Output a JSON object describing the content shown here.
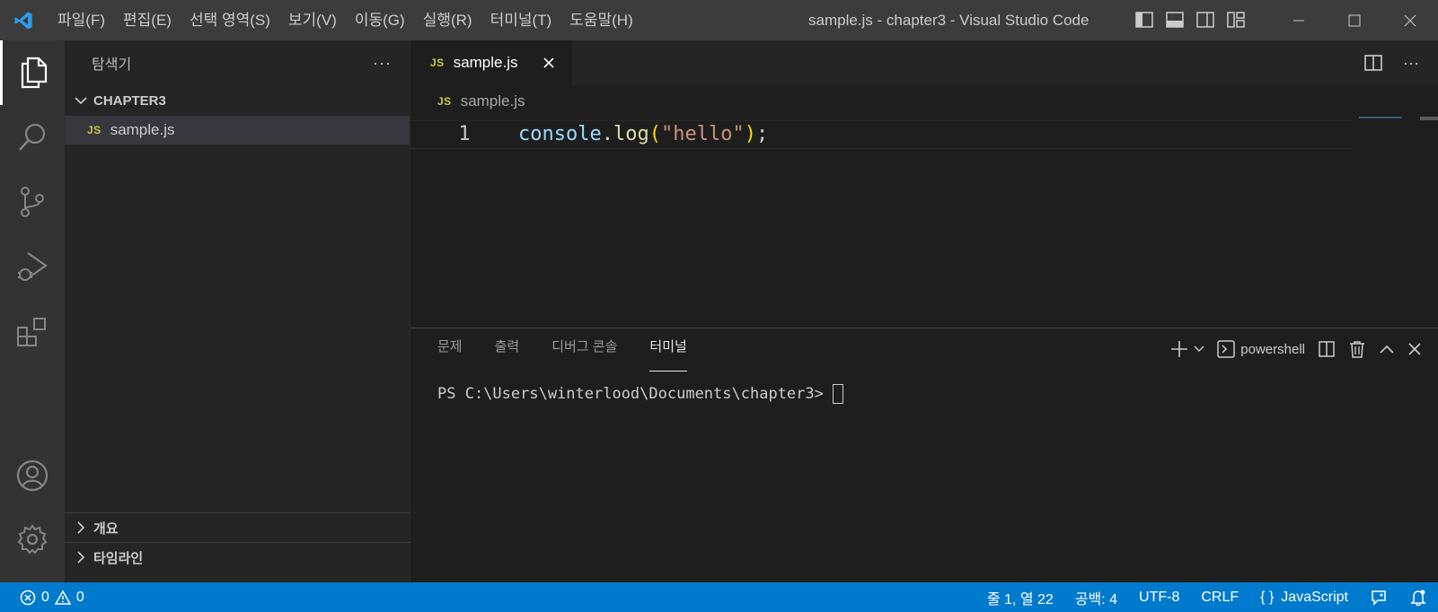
{
  "titlebar": {
    "menu": [
      "파일(F)",
      "편집(E)",
      "선택 영역(S)",
      "보기(V)",
      "이동(G)",
      "실행(R)",
      "터미널(T)",
      "도움말(H)"
    ],
    "title": "sample.js - chapter3 - Visual Studio Code"
  },
  "sidebar": {
    "title": "탐색기",
    "more": "···",
    "root_folder": "CHAPTER3",
    "file": {
      "badge": "JS",
      "name": "sample.js"
    },
    "sections": [
      "개요",
      "타임라인"
    ]
  },
  "editor": {
    "tab": {
      "badge": "JS",
      "label": "sample.js"
    },
    "breadcrumb": {
      "badge": "JS",
      "label": "sample.js"
    },
    "line_number": "1",
    "code": {
      "object": "console",
      "dot": ".",
      "method": "log",
      "open_paren": "(",
      "string": "\"hello\"",
      "close_paren": ")",
      "semicolon": ";"
    },
    "more": "···"
  },
  "panel": {
    "tabs": [
      "문제",
      "출력",
      "디버그 콘솔",
      "터미널"
    ],
    "active_tab": "터미널",
    "shell": "powershell",
    "prompt": "PS C:\\Users\\winterlood\\Documents\\chapter3>"
  },
  "statusbar": {
    "errors": "0",
    "warnings": "0",
    "position": "줄 1, 열 22",
    "spaces": "공백: 4",
    "encoding": "UTF-8",
    "eol": "CRLF",
    "language_braces": "{ }",
    "language": "JavaScript"
  },
  "colors": {
    "accent": "#007acc",
    "titlebar": "#3c3c3c",
    "activitybar": "#333333",
    "sidebar": "#252526",
    "editor": "#1e1e1e"
  }
}
